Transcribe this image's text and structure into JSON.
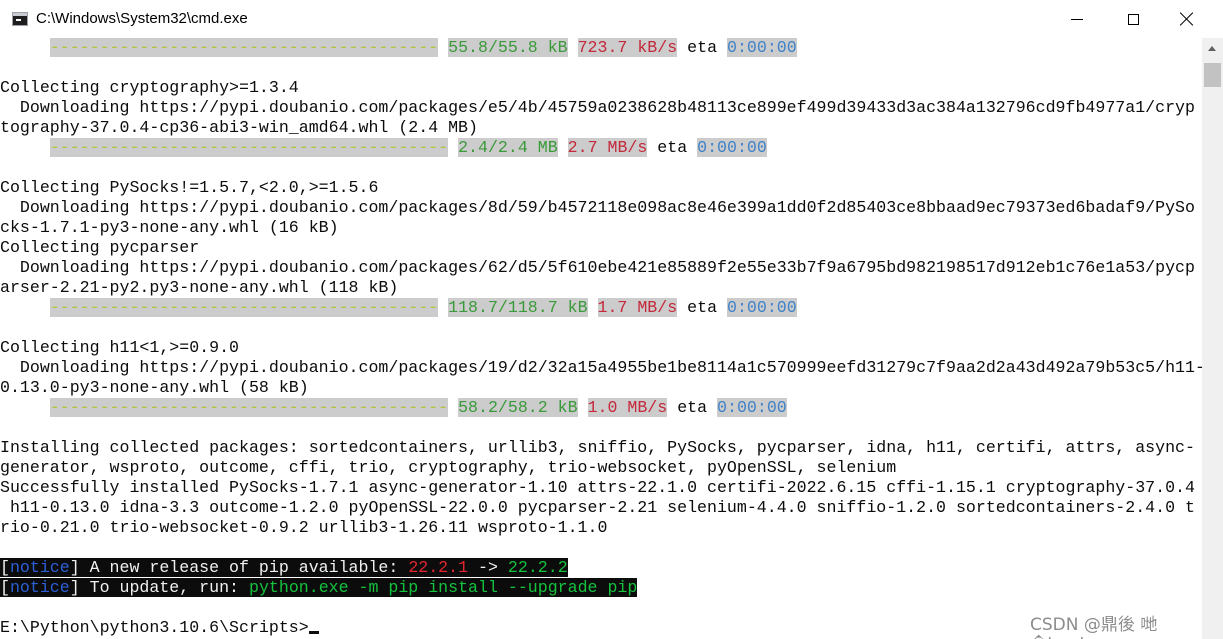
{
  "window": {
    "title": "C:\\Windows\\System32\\cmd.exe",
    "icon": "cmd-icon",
    "controls": [
      "minimize-icon",
      "maximize-icon",
      "close-icon"
    ]
  },
  "console": {
    "l1_bar": "---------------------------------------",
    "l1_size": "55.8/55.8 kB",
    "l1_speed": "723.7 kB/s",
    "l1_eta_label": "eta",
    "l1_eta": "0:00:00",
    "l2": "Collecting cryptography>=1.3.4",
    "l3": "  Downloading https://pypi.doubanio.com/packages/e5/4b/45759a0238628b48113ce899ef499d39433d3ac384a132796cd9fb4977a1/cryp",
    "l4": "tography-37.0.4-cp36-abi3-win_amd64.whl (2.4 MB)",
    "l5_bar": "----------------------------------------",
    "l5_size": "2.4/2.4 MB",
    "l5_speed": "2.7 MB/s",
    "l5_eta_label": "eta",
    "l5_eta": "0:00:00",
    "l6": "Collecting PySocks!=1.5.7,<2.0,>=1.5.6",
    "l7": "  Downloading https://pypi.doubanio.com/packages/8d/59/b4572118e098ac8e46e399a1dd0f2d85403ce8bbaad9ec79373ed6badaf9/PySo",
    "l8": "cks-1.7.1-py3-none-any.whl (16 kB)",
    "l9": "Collecting pycparser",
    "l10": "  Downloading https://pypi.doubanio.com/packages/62/d5/5f610ebe421e85889f2e55e33b7f9a6795bd982198517d912eb1c76e1a53/pycp",
    "l11": "arser-2.21-py2.py3-none-any.whl (118 kB)",
    "l12_bar": "---------------------------------------",
    "l12_size": "118.7/118.7 kB",
    "l12_speed": "1.7 MB/s",
    "l12_eta_label": "eta",
    "l12_eta": "0:00:00",
    "l13": "Collecting h11<1,>=0.9.0",
    "l14": "  Downloading https://pypi.doubanio.com/packages/19/d2/32a15a4955be1be8114a1c570999eefd31279c7f9aa2d2a43d492a79b53c5/h11-",
    "l15": "0.13.0-py3-none-any.whl (58 kB)",
    "l16_bar": "----------------------------------------",
    "l16_size": "58.2/58.2 kB",
    "l16_speed": "1.0 MB/s",
    "l16_eta_label": "eta",
    "l16_eta": "0:00:00",
    "l17": "Installing collected packages: sortedcontainers, urllib3, sniffio, PySocks, pycparser, idna, h11, certifi, attrs, async-",
    "l18": "generator, wsproto, outcome, cffi, trio, cryptography, trio-websocket, pyOpenSSL, selenium",
    "l19": "Successfully installed PySocks-1.7.1 async-generator-1.10 attrs-22.1.0 certifi-2022.6.15 cffi-1.15.1 cryptography-37.0.4",
    "l20": " h11-0.13.0 idna-3.3 outcome-1.2.0 pyOpenSSL-22.0.0 pycparser-2.21 selenium-4.4.0 sniffio-1.2.0 sortedcontainers-2.4.0 t",
    "l21": "rio-0.21.0 trio-websocket-0.9.2 urllib3-1.26.11 wsproto-1.1.0",
    "n1_open": "[",
    "n1_tag": "notice",
    "n1_close": "]",
    "n1_text": " A new release of pip available: ",
    "n1_old": "22.2.1",
    "n1_arrow": " -> ",
    "n1_new": "22.2.2",
    "n2_open": "[",
    "n2_tag": "notice",
    "n2_close": "]",
    "n2_text": " To update, run: ",
    "n2_cmd": "python.exe -m pip install --upgrade pip",
    "prompt": "E:\\Python\\python3.10.6\\Scripts>"
  },
  "watermark": "CSDN @鼎後 哋�london"
}
